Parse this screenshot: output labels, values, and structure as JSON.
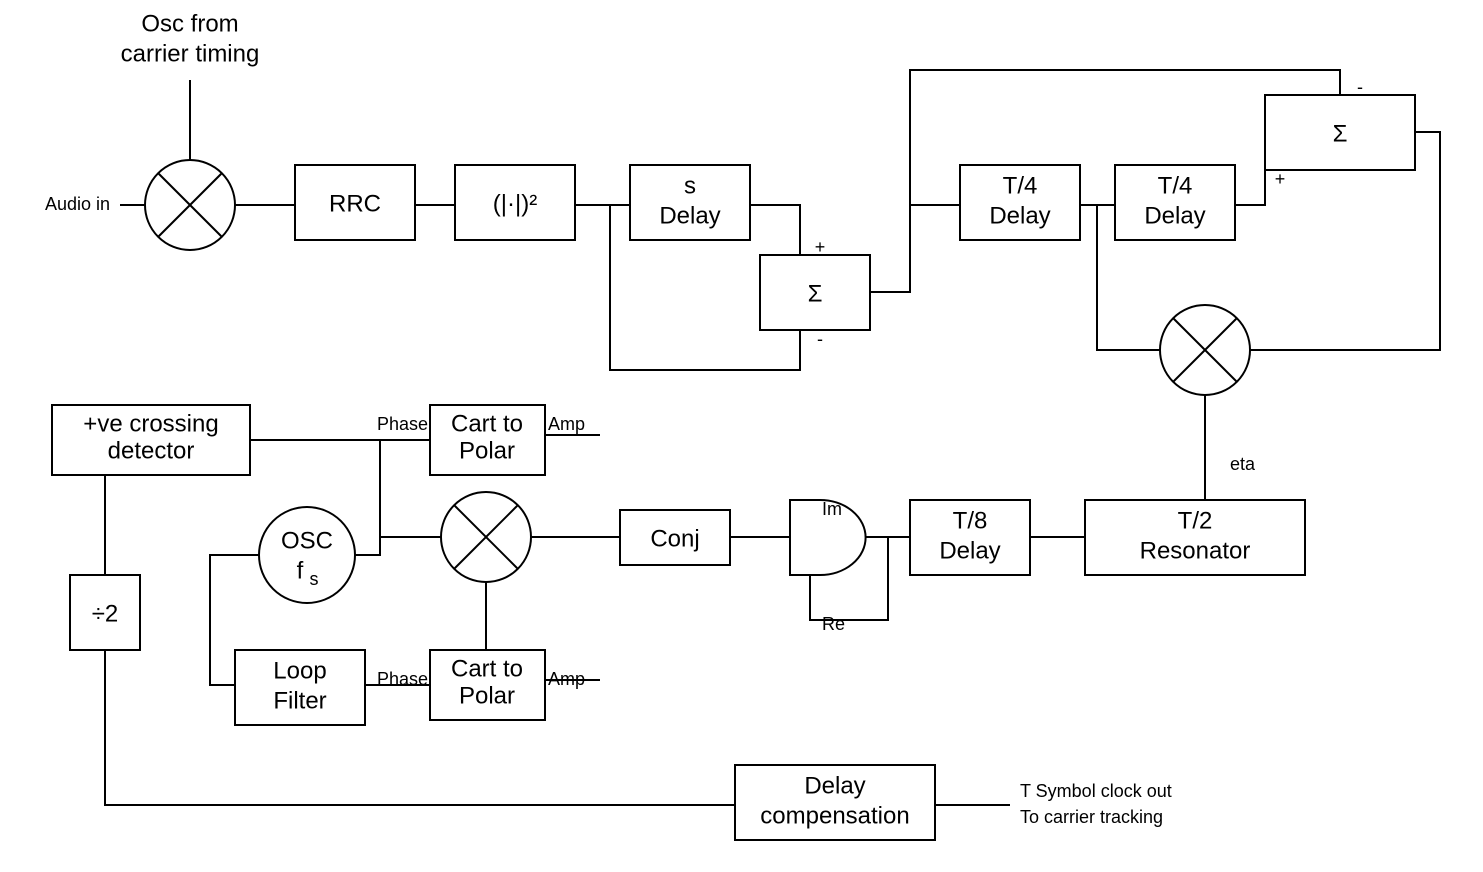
{
  "labels": {
    "osc_caption1": "Osc from",
    "osc_caption2": "carrier timing",
    "audio_in": "Audio in",
    "rrc": "RRC",
    "mag_sq": "(|·|)²",
    "s_delay1": "s",
    "s_delay2": "Delay",
    "sigma": "Σ",
    "t4_1": "T/4",
    "t4_2": "Delay",
    "t8_1": "T/8",
    "t8_2": "Delay",
    "resonator1": "T/2",
    "resonator2": "Resonator",
    "eta": "eta",
    "im": "Im",
    "re": "Re",
    "conj": "Conj",
    "osc_fs1": "OSC",
    "osc_fs2": "f",
    "osc_fs2_sub": "s",
    "c2p1": "Cart to",
    "c2p2": "Polar",
    "phase": "Phase",
    "amp": "Amp",
    "pve1": "+ve crossing",
    "pve2": "detector",
    "div2": "÷2",
    "loop1": "Loop",
    "loop2": "Filter",
    "delay_comp1": "Delay",
    "delay_comp2": "compensation",
    "out1": "T Symbol clock out",
    "out2": "To carrier tracking",
    "plus": "+",
    "minus": "-"
  }
}
